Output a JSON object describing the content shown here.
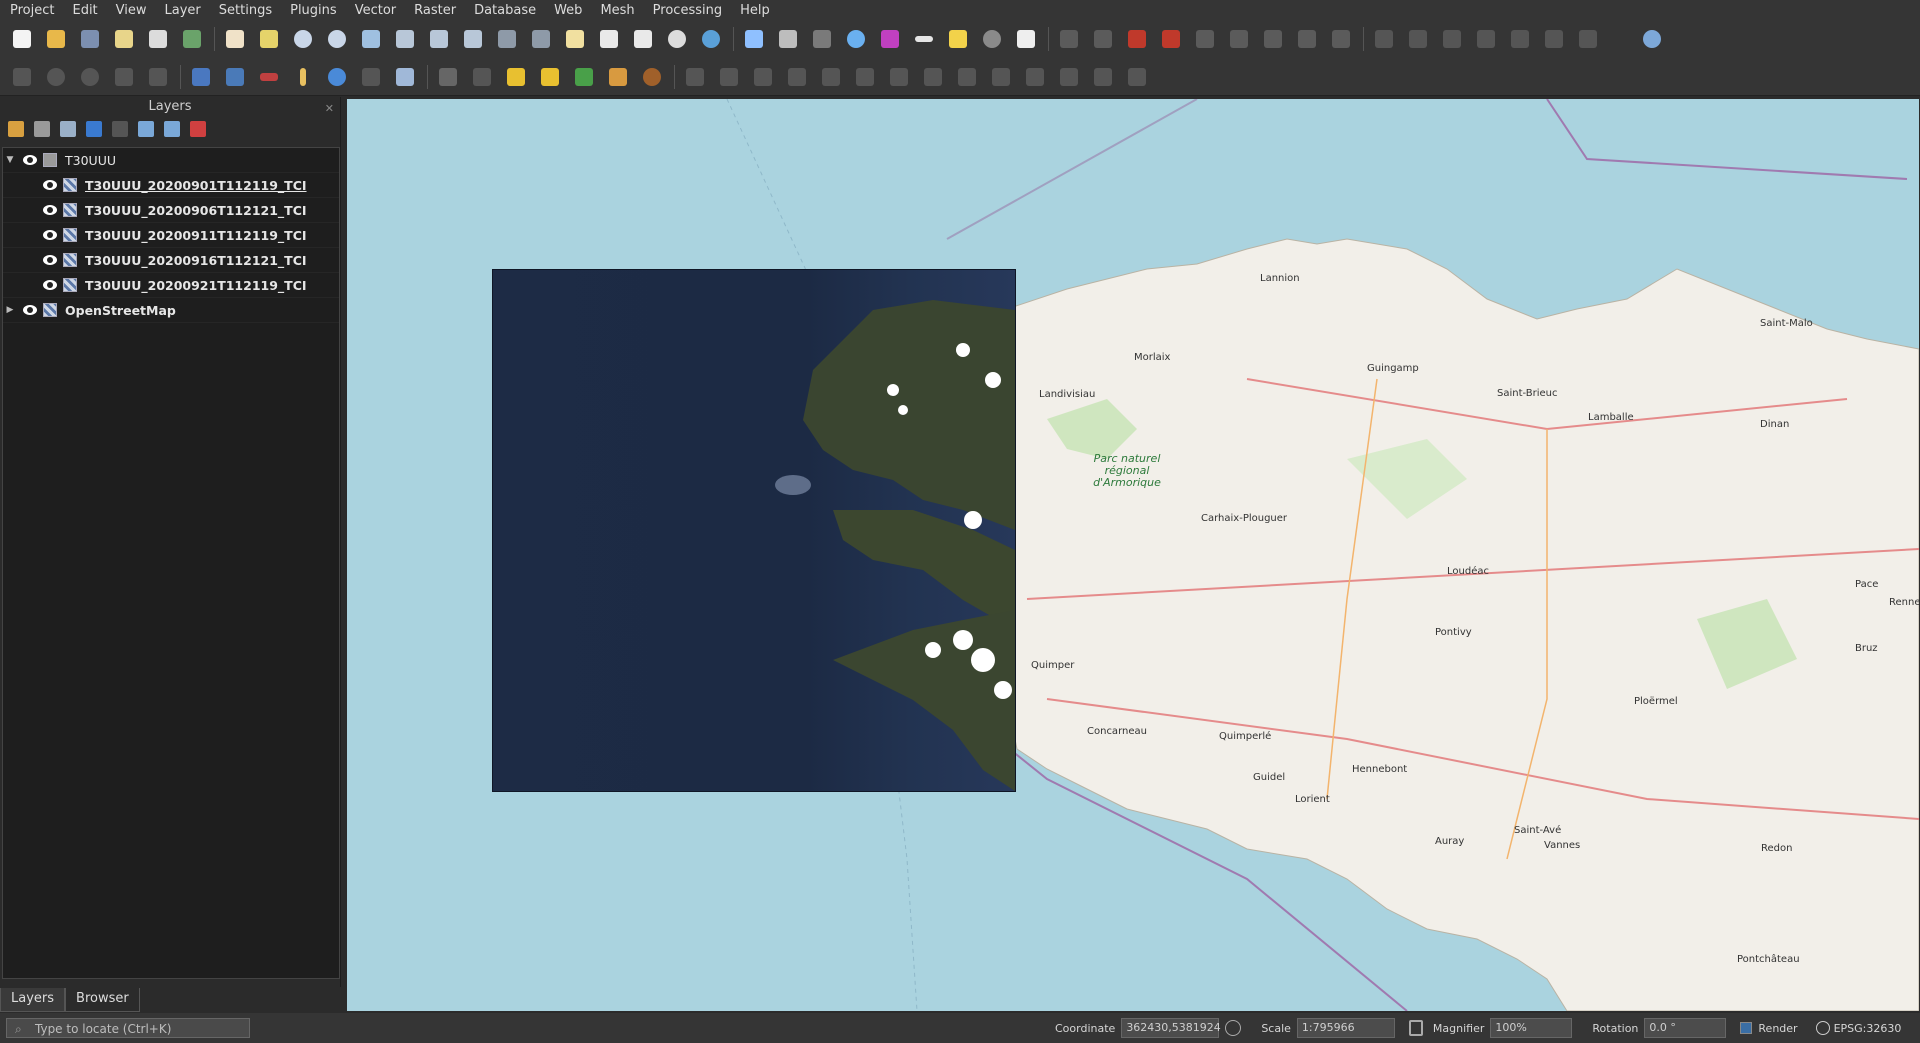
{
  "menu": [
    "Project",
    "Edit",
    "View",
    "Layer",
    "Settings",
    "Plugins",
    "Vector",
    "Raster",
    "Database",
    "Web",
    "Mesh",
    "Processing",
    "Help"
  ],
  "layers_panel": {
    "title": "Layers",
    "group": "T30UUU",
    "children": [
      "T30UUU_20200901T112119_TCI",
      "T30UUU_20200906T112121_TCI",
      "T30UUU_20200911T112119_TCI",
      "T30UUU_20200916T112121_TCI",
      "T30UUU_20200921T112119_TCI"
    ],
    "basemap": "OpenStreetMap"
  },
  "panel_tabs": [
    "Layers",
    "Browser"
  ],
  "map_labels": {
    "towns": [
      "Lannion",
      "Morlaix",
      "Guingamp",
      "Saint-Brieuc",
      "Lamballe",
      "Landivisiau",
      "Saint-Malo",
      "Dinan",
      "Carhaix-Plouguer",
      "Loudéac",
      "Pontivy",
      "Quimper",
      "Concarneau",
      "Quimperlé",
      "Lorient",
      "Guidel",
      "Hennebont",
      "Ploërmel",
      "Vannes",
      "Auray",
      "Redon",
      "Pontchâteau",
      "Saint-Avé",
      "Pace",
      "Bruz",
      "Rennes"
    ],
    "park": "Parc naturel régional d'Armorique"
  },
  "status": {
    "locator_placeholder": "Type to locate (Ctrl+K)",
    "coordinate_label": "Coordinate",
    "coordinate_value": "362430,5381924",
    "scale_label": "Scale",
    "scale_value": "1:795966",
    "magnifier_label": "Magnifier",
    "magnifier_value": "100%",
    "rotation_label": "Rotation",
    "rotation_value": "0.0 °",
    "render_label": "Render",
    "crs": "EPSG:32630"
  }
}
